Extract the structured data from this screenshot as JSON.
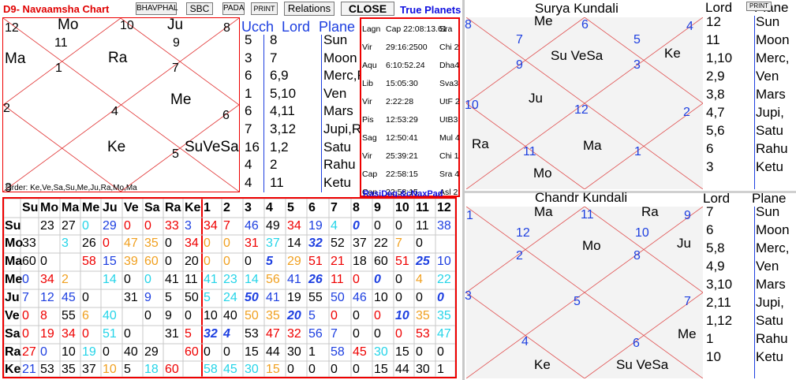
{
  "toolbar": {
    "title": "D9- Navaamsha Chart",
    "buttons": [
      "BHAVPHAL",
      "SBC",
      "PADA",
      "PRINT",
      "Relations",
      "CLOSE"
    ],
    "true_planets": "True Planets"
  },
  "d9_chart": {
    "house_numbers": [
      "12",
      "11",
      "1",
      "10",
      "9",
      "7",
      "8",
      "2",
      "4",
      "3",
      "5",
      "6"
    ],
    "planets": [
      "Mo",
      "Ju",
      "Ma",
      "Ra",
      "Me",
      "Ke",
      "SuVeSa"
    ],
    "order": "Order: Ke,Ve,Sa,Su,Me,Ju,Ra,Mo,Ma"
  },
  "lord_table": {
    "headers": [
      "Ucch",
      "Lord",
      "Plane"
    ],
    "rows": [
      [
        "5",
        "8",
        "Sun"
      ],
      [
        "3",
        "7",
        "Moon"
      ],
      [
        "6",
        "6,9",
        "Merc,R"
      ],
      [
        "1",
        "5,10",
        "Ven"
      ],
      [
        "6",
        "4,11",
        "Mars"
      ],
      [
        "7",
        "3,12",
        "Jupi,R"
      ],
      [
        "16",
        "1,2",
        "Satu"
      ],
      [
        "4",
        "2",
        "Rahu"
      ],
      [
        "4",
        "11",
        "Ketu"
      ]
    ]
  },
  "degrees": {
    "rows": [
      [
        "Lagn",
        "Cap 22:08:13.61",
        "Sra"
      ],
      [
        "Vir",
        "29:16:2500",
        "Chi 2"
      ],
      [
        "Aqu",
        "6:10:52.24",
        "Dha4"
      ],
      [
        "Lib",
        "15:05:30",
        "Sva3"
      ],
      [
        "Vir",
        "2:22:28",
        "UtF 2"
      ],
      [
        "Pis",
        "12:53:29",
        "UtB3"
      ],
      [
        "Sag",
        "12:50:41",
        "Mul 4"
      ],
      [
        "Vir",
        "25:39:21",
        "Chi 1"
      ],
      [
        "Cap",
        "22:58:15",
        "Sra 4"
      ],
      [
        "Can",
        "22:58:15",
        "Asl 2"
      ]
    ],
    "footer": "RasiDeg.&cNaxPad"
  },
  "aspect_grid": {
    "col_headers": [
      "Su",
      "Mo",
      "Ma",
      "Me",
      "Ju",
      "Ve",
      "Sa",
      "Ra",
      "Ke",
      "1",
      "2",
      "3",
      "4",
      "5",
      "6",
      "7",
      "8",
      "9",
      "10",
      "11",
      "12"
    ],
    "rows": [
      {
        "label": "Su",
        "cells": [
          {
            "v": "",
            "c": "#000"
          },
          {
            "v": "23",
            "c": "#000"
          },
          {
            "v": "27",
            "c": "#000"
          },
          {
            "v": "0",
            "c": "#25d4e8"
          },
          {
            "v": "29",
            "c": "#1d3fe0"
          },
          {
            "v": "0",
            "c": "#e00"
          },
          {
            "v": "0",
            "c": "#e00"
          },
          {
            "v": "33",
            "c": "#e00"
          },
          {
            "v": "3",
            "c": "#1d3fe0"
          },
          {
            "v": "34",
            "c": "#e00"
          },
          {
            "v": "7",
            "c": "#e00"
          },
          {
            "v": "46",
            "c": "#1d3fe0"
          },
          {
            "v": "49",
            "c": "#000"
          },
          {
            "v": "34",
            "c": "#e00"
          },
          {
            "v": "19",
            "c": "#1d3fe0"
          },
          {
            "v": "4",
            "c": "#25d4e8"
          },
          {
            "v": "0",
            "c": "#1d3fe0",
            "b": 1
          },
          {
            "v": "0",
            "c": "#000"
          },
          {
            "v": "0",
            "c": "#000"
          },
          {
            "v": "11",
            "c": "#000"
          },
          {
            "v": "38",
            "c": "#1d3fe0"
          }
        ]
      },
      {
        "label": "Mo",
        "cells": [
          {
            "v": "33",
            "c": "#000"
          },
          {
            "v": "",
            "c": "#000"
          },
          {
            "v": "3",
            "c": "#25d4e8"
          },
          {
            "v": "26",
            "c": "#000"
          },
          {
            "v": "0",
            "c": "#e00"
          },
          {
            "v": "47",
            "c": "#f0a020"
          },
          {
            "v": "35",
            "c": "#f0a020"
          },
          {
            "v": "0",
            "c": "#000"
          },
          {
            "v": "34",
            "c": "#e00"
          },
          {
            "v": "0",
            "c": "#f0a020"
          },
          {
            "v": "0",
            "c": "#f0a020"
          },
          {
            "v": "31",
            "c": "#e00"
          },
          {
            "v": "37",
            "c": "#25d4e8"
          },
          {
            "v": "14",
            "c": "#000"
          },
          {
            "v": "32",
            "c": "#1d3fe0",
            "b": 1
          },
          {
            "v": "52",
            "c": "#000"
          },
          {
            "v": "37",
            "c": "#000"
          },
          {
            "v": "22",
            "c": "#000"
          },
          {
            "v": "7",
            "c": "#f0a020"
          },
          {
            "v": "0",
            "c": "#000"
          },
          {
            "v": "",
            "c": "#000"
          }
        ]
      },
      {
        "label": "Ma",
        "cells": [
          {
            "v": "60",
            "c": "#000"
          },
          {
            "v": "0",
            "c": "#000"
          },
          {
            "v": "",
            "c": "#000"
          },
          {
            "v": "58",
            "c": "#e00"
          },
          {
            "v": "15",
            "c": "#1d3fe0"
          },
          {
            "v": "39",
            "c": "#f0a020"
          },
          {
            "v": "60",
            "c": "#f0a020"
          },
          {
            "v": "0",
            "c": "#000"
          },
          {
            "v": "20",
            "c": "#000"
          },
          {
            "v": "0",
            "c": "#f0a020"
          },
          {
            "v": "0",
            "c": "#f0a020"
          },
          {
            "v": "0",
            "c": "#000"
          },
          {
            "v": "5",
            "c": "#1d3fe0",
            "b": 1
          },
          {
            "v": "29",
            "c": "#f0a020"
          },
          {
            "v": "51",
            "c": "#e00"
          },
          {
            "v": "21",
            "c": "#e00"
          },
          {
            "v": "18",
            "c": "#000"
          },
          {
            "v": "60",
            "c": "#000"
          },
          {
            "v": "51",
            "c": "#e00"
          },
          {
            "v": "25",
            "c": "#1d3fe0",
            "b": 1
          },
          {
            "v": "10",
            "c": "#1d3fe0"
          }
        ]
      },
      {
        "label": "Me",
        "cells": [
          {
            "v": "0",
            "c": "#1d3fe0"
          },
          {
            "v": "34",
            "c": "#e00"
          },
          {
            "v": "2",
            "c": "#f0a020"
          },
          {
            "v": "",
            "c": "#000"
          },
          {
            "v": "14",
            "c": "#25d4e8"
          },
          {
            "v": "0",
            "c": "#000"
          },
          {
            "v": "0",
            "c": "#25d4e8"
          },
          {
            "v": "41",
            "c": "#000"
          },
          {
            "v": "11",
            "c": "#000"
          },
          {
            "v": "41",
            "c": "#25d4e8"
          },
          {
            "v": "23",
            "c": "#25d4e8"
          },
          {
            "v": "14",
            "c": "#25d4e8"
          },
          {
            "v": "56",
            "c": "#f0a020"
          },
          {
            "v": "41",
            "c": "#1d3fe0"
          },
          {
            "v": "26",
            "c": "#1d3fe0",
            "b": 1
          },
          {
            "v": "11",
            "c": "#e00"
          },
          {
            "v": "0",
            "c": "#e00"
          },
          {
            "v": "0",
            "c": "#1d3fe0",
            "b": 1
          },
          {
            "v": "0",
            "c": "#000"
          },
          {
            "v": "4",
            "c": "#f0a020"
          },
          {
            "v": "22",
            "c": "#25d4e8"
          }
        ]
      },
      {
        "label": "Ju",
        "cells": [
          {
            "v": "7",
            "c": "#1d3fe0"
          },
          {
            "v": "12",
            "c": "#1d3fe0"
          },
          {
            "v": "45",
            "c": "#1d3fe0"
          },
          {
            "v": "0",
            "c": "#000"
          },
          {
            "v": "",
            "c": "#000"
          },
          {
            "v": "31",
            "c": "#000"
          },
          {
            "v": "9",
            "c": "#1d3fe0"
          },
          {
            "v": "5",
            "c": "#000"
          },
          {
            "v": "50",
            "c": "#000"
          },
          {
            "v": "5",
            "c": "#25d4e8"
          },
          {
            "v": "24",
            "c": "#25d4e8"
          },
          {
            "v": "50",
            "c": "#1d3fe0",
            "b": 1
          },
          {
            "v": "41",
            "c": "#1d3fe0"
          },
          {
            "v": "19",
            "c": "#000"
          },
          {
            "v": "55",
            "c": "#000"
          },
          {
            "v": "50",
            "c": "#1d3fe0"
          },
          {
            "v": "46",
            "c": "#1d3fe0"
          },
          {
            "v": "10",
            "c": "#000"
          },
          {
            "v": "0",
            "c": "#000"
          },
          {
            "v": "0",
            "c": "#000"
          },
          {
            "v": "0",
            "c": "#1d3fe0",
            "b": 1
          }
        ]
      },
      {
        "label": "Ve",
        "cells": [
          {
            "v": "0",
            "c": "#e00"
          },
          {
            "v": "8",
            "c": "#e00"
          },
          {
            "v": "55",
            "c": "#000"
          },
          {
            "v": "6",
            "c": "#f0a020"
          },
          {
            "v": "40",
            "c": "#25d4e8"
          },
          {
            "v": "",
            "c": "#000"
          },
          {
            "v": "0",
            "c": "#000"
          },
          {
            "v": "9",
            "c": "#000"
          },
          {
            "v": "0",
            "c": "#000"
          },
          {
            "v": "10",
            "c": "#000"
          },
          {
            "v": "40",
            "c": "#000"
          },
          {
            "v": "50",
            "c": "#f0a020"
          },
          {
            "v": "35",
            "c": "#f0a020"
          },
          {
            "v": "20",
            "c": "#1d3fe0",
            "b": 1
          },
          {
            "v": "5",
            "c": "#1d3fe0"
          },
          {
            "v": "0",
            "c": "#e00"
          },
          {
            "v": "0",
            "c": "#000"
          },
          {
            "v": "0",
            "c": "#e00"
          },
          {
            "v": "10",
            "c": "#1d3fe0",
            "b": 1
          },
          {
            "v": "35",
            "c": "#f0a020"
          },
          {
            "v": "35",
            "c": "#25d4e8"
          }
        ]
      },
      {
        "label": "Sa",
        "cells": [
          {
            "v": "0",
            "c": "#e00"
          },
          {
            "v": "19",
            "c": "#e00"
          },
          {
            "v": "34",
            "c": "#e00"
          },
          {
            "v": "0",
            "c": "#e00"
          },
          {
            "v": "51",
            "c": "#25d4e8"
          },
          {
            "v": "0",
            "c": "#000"
          },
          {
            "v": "",
            "c": "#000"
          },
          {
            "v": "31",
            "c": "#000"
          },
          {
            "v": "5",
            "c": "#e00"
          },
          {
            "v": "32",
            "c": "#1d3fe0",
            "b": 1
          },
          {
            "v": "4",
            "c": "#1d3fe0",
            "b": 1
          },
          {
            "v": "53",
            "c": "#000"
          },
          {
            "v": "47",
            "c": "#e00"
          },
          {
            "v": "32",
            "c": "#e00"
          },
          {
            "v": "56",
            "c": "#1d3fe0"
          },
          {
            "v": "7",
            "c": "#1d3fe0"
          },
          {
            "v": "0",
            "c": "#000"
          },
          {
            "v": "0",
            "c": "#000"
          },
          {
            "v": "0",
            "c": "#e00"
          },
          {
            "v": "53",
            "c": "#e00"
          },
          {
            "v": "47",
            "c": "#25d4e8"
          }
        ]
      },
      {
        "label": "Ra",
        "cells": [
          {
            "v": "27",
            "c": "#e00"
          },
          {
            "v": "0",
            "c": "#1d3fe0"
          },
          {
            "v": "10",
            "c": "#000"
          },
          {
            "v": "19",
            "c": "#25d4e8"
          },
          {
            "v": "0",
            "c": "#000"
          },
          {
            "v": "40",
            "c": "#000"
          },
          {
            "v": "29",
            "c": "#000"
          },
          {
            "v": "",
            "c": "#000"
          },
          {
            "v": "60",
            "c": "#e00"
          },
          {
            "v": "0",
            "c": "#000"
          },
          {
            "v": "0",
            "c": "#000"
          },
          {
            "v": "15",
            "c": "#000"
          },
          {
            "v": "44",
            "c": "#000"
          },
          {
            "v": "30",
            "c": "#000"
          },
          {
            "v": "1",
            "c": "#000"
          },
          {
            "v": "58",
            "c": "#1d3fe0"
          },
          {
            "v": "45",
            "c": "#e00"
          },
          {
            "v": "30",
            "c": "#25d4e8"
          },
          {
            "v": "15",
            "c": "#000"
          },
          {
            "v": "0",
            "c": "#000"
          },
          {
            "v": "0",
            "c": "#000"
          }
        ]
      },
      {
        "label": "Ke",
        "cells": [
          {
            "v": "21",
            "c": "#1d3fe0"
          },
          {
            "v": "53",
            "c": "#000"
          },
          {
            "v": "35",
            "c": "#000"
          },
          {
            "v": "37",
            "c": "#000"
          },
          {
            "v": "10",
            "c": "#f0a020"
          },
          {
            "v": "5",
            "c": "#000"
          },
          {
            "v": "18",
            "c": "#25d4e8"
          },
          {
            "v": "60",
            "c": "#e00"
          },
          {
            "v": "",
            "c": "#000"
          },
          {
            "v": "58",
            "c": "#25d4e8"
          },
          {
            "v": "45",
            "c": "#25d4e8"
          },
          {
            "v": "30",
            "c": "#25d4e8"
          },
          {
            "v": "15",
            "c": "#f0a020"
          },
          {
            "v": "0",
            "c": "#000"
          },
          {
            "v": "0",
            "c": "#000"
          },
          {
            "v": "0",
            "c": "#000"
          },
          {
            "v": "0",
            "c": "#000"
          },
          {
            "v": "15",
            "c": "#000"
          },
          {
            "v": "44",
            "c": "#000"
          },
          {
            "v": "30",
            "c": "#000"
          },
          {
            "v": "1",
            "c": "#000"
          }
        ]
      }
    ]
  },
  "surya_kundali": {
    "title": "Surya Kundali",
    "print_label": "PRINT",
    "house_numbers": [
      "8",
      "6",
      "4",
      "7",
      "9",
      "5",
      "3",
      "10",
      "12",
      "2",
      "11",
      "1"
    ],
    "planets": [
      "Me",
      "Su VeSa",
      "Ke",
      "Ju",
      "Ra",
      "Ma",
      "Mo"
    ],
    "headers": [
      "Lord",
      "Plane"
    ],
    "lords": [
      "12",
      "11",
      "1,10",
      "2,9",
      "3,8",
      "4,7",
      "5,6",
      "6",
      "3"
    ],
    "planet_names": [
      "Sun",
      "Moon",
      "Merc,",
      "Ven",
      "Mars",
      "Jupi,",
      "Satu",
      "Rahu",
      "Ketu"
    ]
  },
  "chandr_kundali": {
    "title": "Chandr Kundali",
    "house_numbers": [
      "1",
      "11",
      "9",
      "12",
      "10",
      "2",
      "8",
      "3",
      "5",
      "7",
      "4",
      "6"
    ],
    "planets": [
      "Ma",
      "Ra",
      "Mo",
      "Ju",
      "Me",
      "Ke",
      "Su VeSa"
    ],
    "headers": [
      "Lord",
      "Plane"
    ],
    "lords": [
      "7",
      "6",
      "5,8",
      "4,9",
      "3,10",
      "2,11",
      "1,12",
      "1",
      "10"
    ],
    "planet_names": [
      "Sun",
      "Moon",
      "Merc,",
      "Ven",
      "Mars",
      "Jupi,",
      "Satu",
      "Rahu",
      "Ketu"
    ]
  }
}
